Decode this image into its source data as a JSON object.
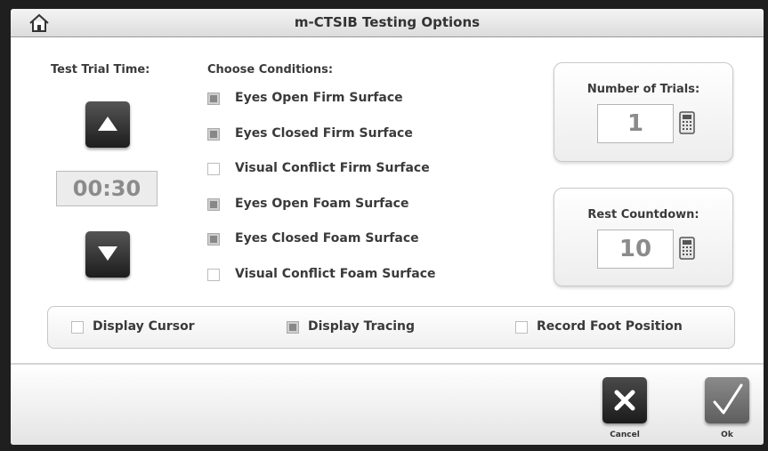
{
  "window": {
    "title": "m-CTSIB Testing Options"
  },
  "trial_time": {
    "label": "Test Trial Time:",
    "value": "00:30"
  },
  "conditions": {
    "label": "Choose Conditions:",
    "items": [
      {
        "label": "Eyes Open Firm Surface",
        "checked": true
      },
      {
        "label": "Eyes Closed Firm Surface",
        "checked": true
      },
      {
        "label": "Visual Conflict Firm Surface",
        "checked": false
      },
      {
        "label": "Eyes Open Foam Surface",
        "checked": true
      },
      {
        "label": "Eyes Closed Foam Surface",
        "checked": true
      },
      {
        "label": "Visual Conflict Foam Surface",
        "checked": false
      }
    ]
  },
  "trials": {
    "label": "Number of Trials:",
    "value": "1"
  },
  "rest": {
    "label": "Rest Countdown:",
    "value": "10"
  },
  "options": {
    "display_cursor": {
      "label": "Display Cursor",
      "checked": false
    },
    "display_tracing": {
      "label": "Display Tracing",
      "checked": true
    },
    "record_foot_position": {
      "label": "Record Foot Position",
      "checked": false
    }
  },
  "footer": {
    "cancel_label": "Cancel",
    "ok_label": "Ok"
  },
  "icons": {
    "home": "home-icon",
    "up": "up-arrow-icon",
    "down": "down-arrow-icon",
    "calculator": "calculator-icon",
    "cancel": "x-icon",
    "ok": "checkmark-icon"
  }
}
